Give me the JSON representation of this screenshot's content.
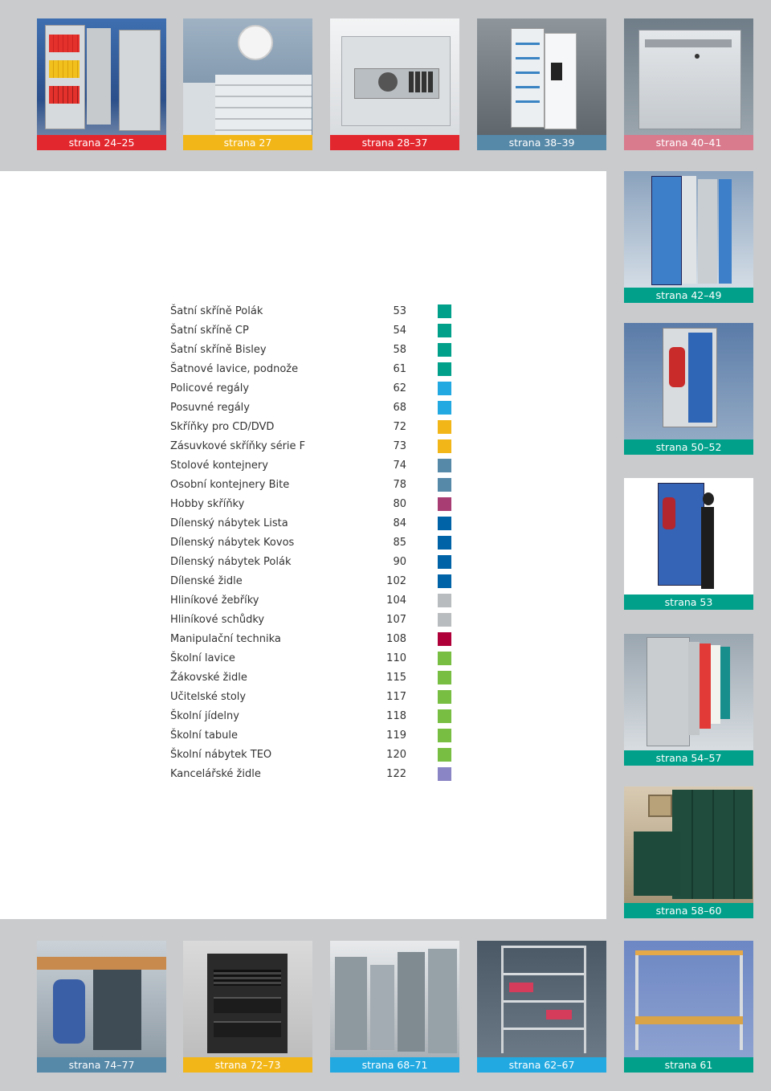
{
  "colors": {
    "red": "#e3272e",
    "yellow": "#f2b619",
    "steel_blue": "#5688a8",
    "pink": "#d97a8d",
    "teal": "#00a08a",
    "sky": "#23a9e1",
    "royal": "#0063a8",
    "gray": "#b9bcbe",
    "crimson": "#b0003a",
    "green": "#78be43",
    "lavender": "#8a85c4",
    "magenta": "#a83d73"
  },
  "top_row": [
    {
      "caption": "strana 24–25",
      "color": "#e3272e",
      "photo": "filing-cabinet-photo"
    },
    {
      "caption": "strana 27",
      "color": "#f2b619",
      "photo": "plan-chest-drawers-photo"
    },
    {
      "caption": "strana 28–37",
      "color": "#e3272e",
      "photo": "electronic-safe-photo"
    },
    {
      "caption": "strana 38–39",
      "color": "#5688a8",
      "photo": "key-cabinet-photo"
    },
    {
      "caption": "strana 40–41",
      "color": "#d97a8d",
      "photo": "letterbox-photo"
    }
  ],
  "right_column": [
    {
      "caption": "strana 42–49",
      "color": "#00a08a",
      "photo": "blue-lockers-photo"
    },
    {
      "caption": "strana 50–52",
      "color": "#00a08a",
      "photo": "blue-locker-clothes-photo"
    },
    {
      "caption": "strana 53",
      "color": "#00a08a",
      "photo": "woman-at-locker-photo"
    },
    {
      "caption": "strana 54–57",
      "color": "#00a08a",
      "photo": "color-lockers-row-photo"
    },
    {
      "caption": "strana 58–60",
      "color": "#00a08a",
      "photo": "green-changing-room-photo"
    }
  ],
  "bottom_row": [
    {
      "caption": "strana 74–77",
      "color": "#5688a8",
      "photo": "desk-pedestal-photo"
    },
    {
      "caption": "strana 72–73",
      "color": "#f2b619",
      "photo": "black-drawer-cabinet-photo"
    },
    {
      "caption": "strana 68–71",
      "color": "#23a9e1",
      "photo": "mobile-shelving-photo"
    },
    {
      "caption": "strana 62–67",
      "color": "#23a9e1",
      "photo": "metal-shelf-photo"
    },
    {
      "caption": "strana 61",
      "color": "#00a08a",
      "photo": "bench-with-hooks-photo"
    }
  ],
  "toc": [
    {
      "label": "Šatní skříně Polák",
      "page": "53",
      "color": "#00a08a"
    },
    {
      "label": "Šatní skříně CP",
      "page": "54",
      "color": "#00a08a"
    },
    {
      "label": "Šatní skříně Bisley",
      "page": "58",
      "color": "#00a08a"
    },
    {
      "label": "Šatnové lavice, podnože",
      "page": "61",
      "color": "#00a08a"
    },
    {
      "label": "Policové regály",
      "page": "62",
      "color": "#23a9e1"
    },
    {
      "label": "Posuvné regály",
      "page": "68",
      "color": "#23a9e1"
    },
    {
      "label": "Skříňky pro CD/DVD",
      "page": "72",
      "color": "#f2b619"
    },
    {
      "label": "Zásuvkové skříňky série F",
      "page": "73",
      "color": "#f2b619"
    },
    {
      "label": "Stolové kontejnery",
      "page": "74",
      "color": "#5688a8"
    },
    {
      "label": "Osobní kontejnery Bite",
      "page": "78",
      "color": "#5688a8"
    },
    {
      "label": "Hobby skříňky",
      "page": "80",
      "color": "#a83d73"
    },
    {
      "label": "Dílenský nábytek Lista",
      "page": "84",
      "color": "#0063a8"
    },
    {
      "label": "Dílenský nábytek Kovos",
      "page": "85",
      "color": "#0063a8"
    },
    {
      "label": "Dílenský nábytek Polák",
      "page": "90",
      "color": "#0063a8"
    },
    {
      "label": "Dílenské židle",
      "page": "102",
      "color": "#0063a8"
    },
    {
      "label": "Hliníkové žebříky",
      "page": "104",
      "color": "#b9bcbe"
    },
    {
      "label": "Hliníkové schůdky",
      "page": "107",
      "color": "#b9bcbe"
    },
    {
      "label": "Manipulační technika",
      "page": "108",
      "color": "#b0003a"
    },
    {
      "label": "Školní lavice",
      "page": "110",
      "color": "#78be43"
    },
    {
      "label": "Žákovské židle",
      "page": "115",
      "color": "#78be43"
    },
    {
      "label": "Učitelské stoly",
      "page": "117",
      "color": "#78be43"
    },
    {
      "label": "Školní jídelny",
      "page": "118",
      "color": "#78be43"
    },
    {
      "label": "Školní tabule",
      "page": "119",
      "color": "#78be43"
    },
    {
      "label": "Školní nábytek TEO",
      "page": "120",
      "color": "#78be43"
    },
    {
      "label": "Kancelářské židle",
      "page": "122",
      "color": "#8a85c4"
    }
  ]
}
